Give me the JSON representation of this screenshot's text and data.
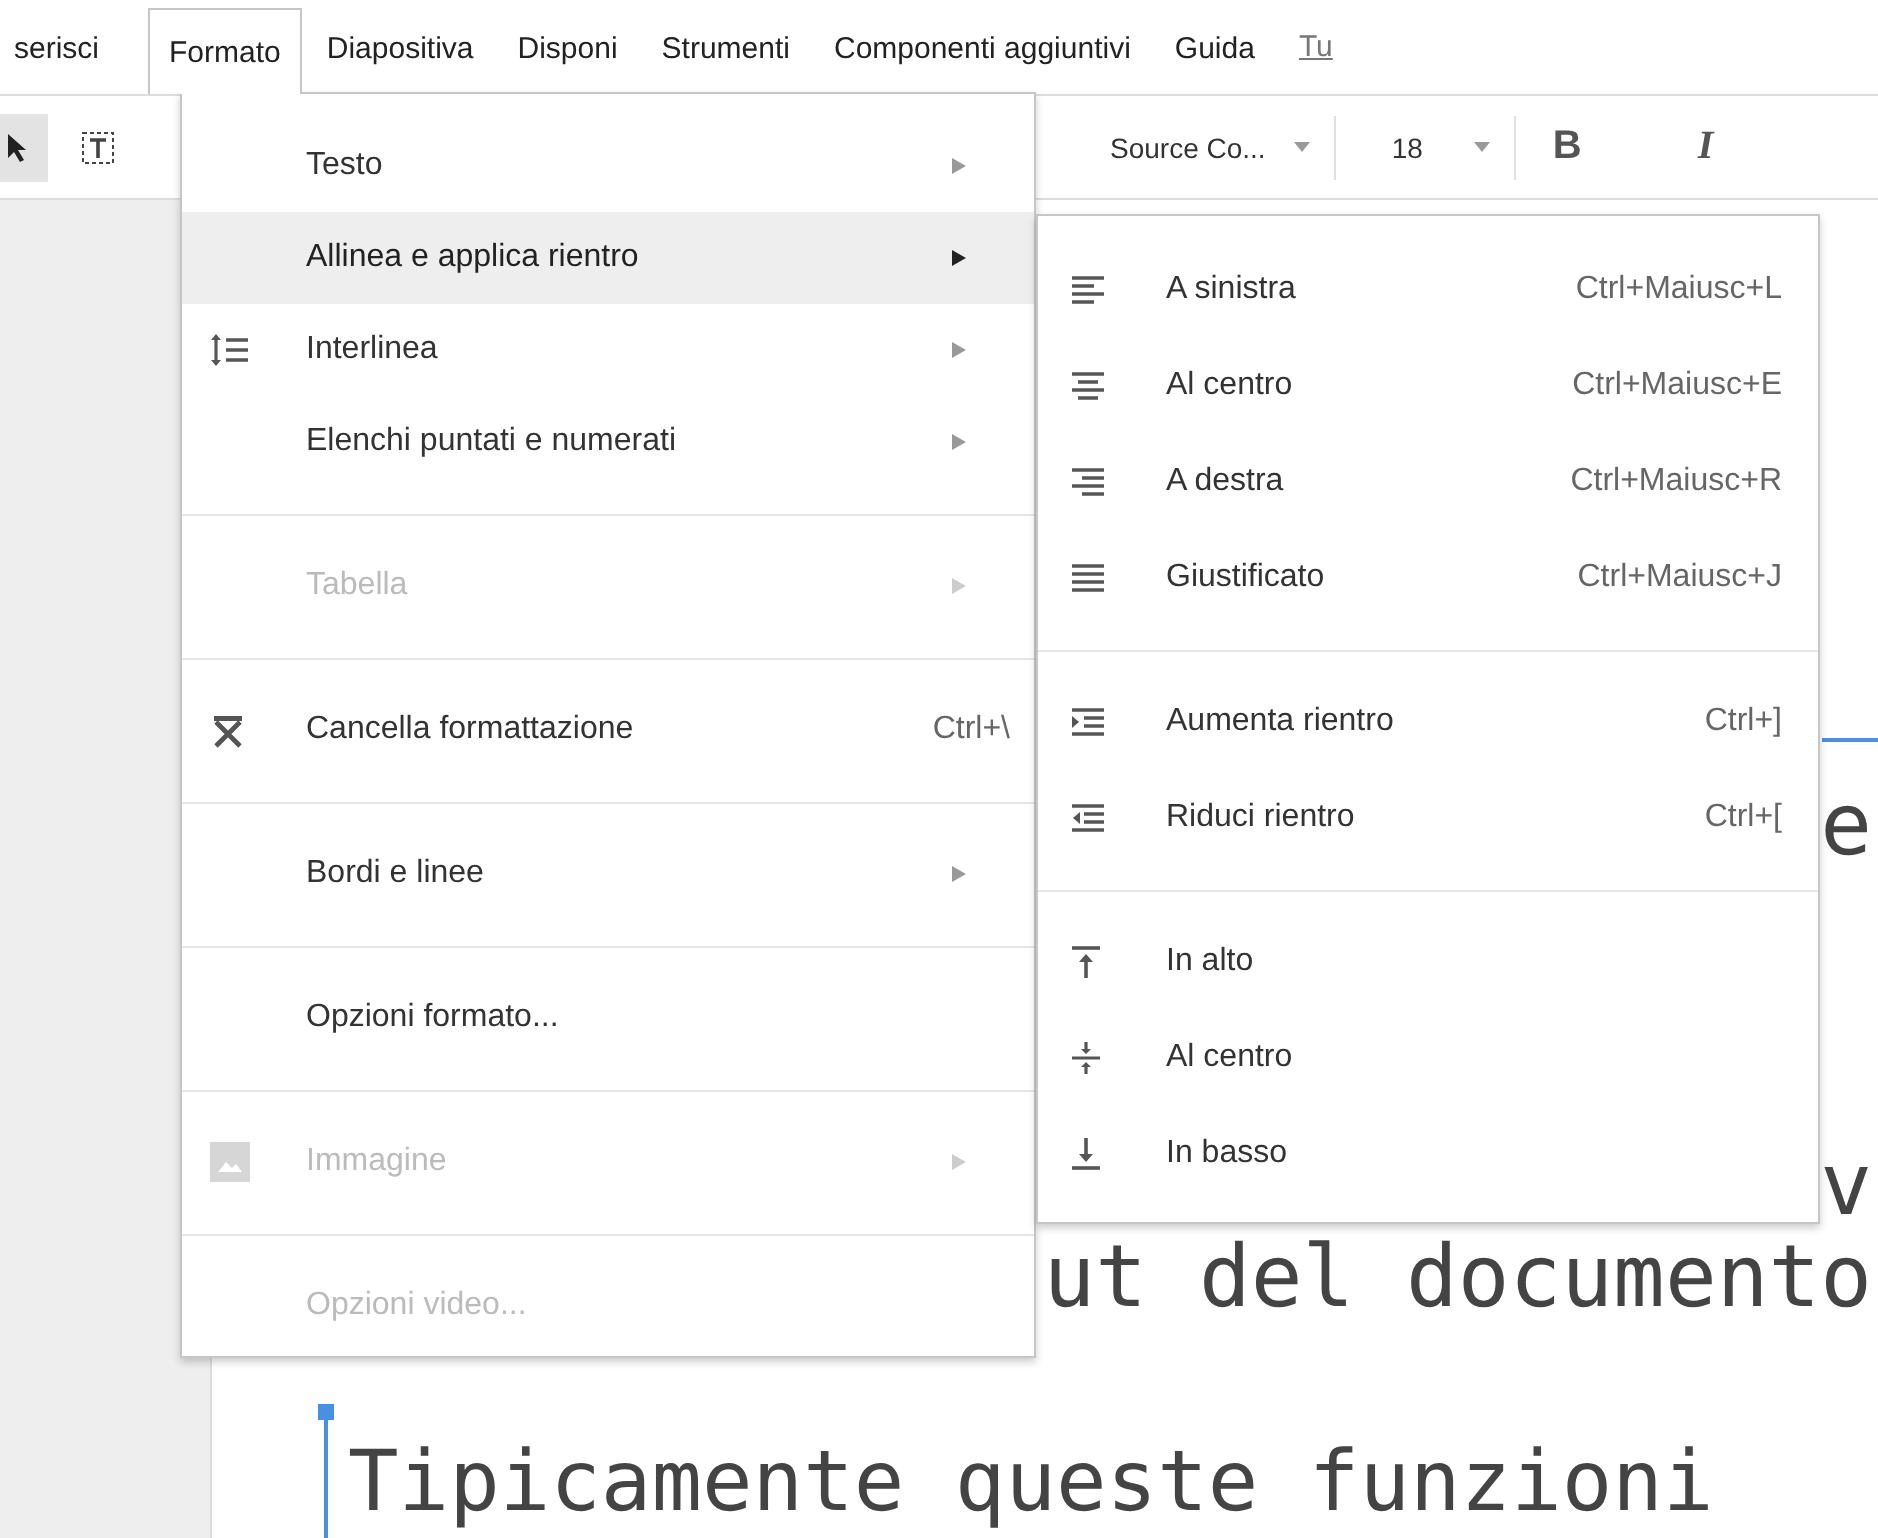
{
  "menubar": {
    "items": [
      {
        "label": "serisci",
        "selected": false
      },
      {
        "label": "Formato",
        "selected": true
      },
      {
        "label": "Diapositiva",
        "selected": false
      },
      {
        "label": "Disponi",
        "selected": false
      },
      {
        "label": "Strumenti",
        "selected": false
      },
      {
        "label": "Componenti aggiuntivi",
        "selected": false
      },
      {
        "label": "Guida",
        "selected": false
      }
    ],
    "status_link": "Tu"
  },
  "toolbar": {
    "tools": [
      {
        "kind": "pointer",
        "selected": true
      },
      {
        "kind": "textbox",
        "selected": false
      }
    ],
    "font": "Source Co...",
    "size": "18",
    "bold": "B",
    "italic": "I"
  },
  "slide": {
    "lines": [
      "e",
      "v",
      "ut del documento"
    ],
    "text_box": "Tipicamente queste funzioni"
  },
  "menu": {
    "items": [
      {
        "kind": "item",
        "label": "Testo",
        "submenu": true,
        "disabled": false,
        "selected": false
      },
      {
        "kind": "item",
        "label": "Allinea e applica rientro",
        "submenu": true,
        "disabled": false,
        "selected": true
      },
      {
        "kind": "item",
        "label": "Interlinea",
        "submenu": true,
        "disabled": false,
        "selected": false
      },
      {
        "kind": "item",
        "label": "Elenchi puntati e numerati",
        "submenu": true,
        "disabled": false,
        "selected": false
      },
      {
        "kind": "separator"
      },
      {
        "kind": "item",
        "label": "Tabella",
        "submenu": true,
        "disabled": true,
        "selected": false
      },
      {
        "kind": "separator"
      },
      {
        "kind": "item",
        "label": "Cancella formattazione",
        "shortcut": "Ctrl+\\",
        "submenu": false,
        "disabled": false,
        "selected": false
      },
      {
        "kind": "separator"
      },
      {
        "kind": "item",
        "label": "Bordi e linee",
        "submenu": true,
        "disabled": false,
        "selected": false
      },
      {
        "kind": "separator"
      },
      {
        "kind": "item",
        "label": "Opzioni formato...",
        "submenu": false,
        "disabled": false,
        "selected": false
      },
      {
        "kind": "separator"
      },
      {
        "kind": "item",
        "label": "Immagine",
        "submenu": true,
        "disabled": true,
        "selected": false
      },
      {
        "kind": "separator"
      },
      {
        "kind": "item",
        "label": "Opzioni video...",
        "submenu": false,
        "disabled": true,
        "selected": false
      }
    ]
  },
  "submenu": {
    "items": [
      {
        "kind": "item",
        "label": "A sinistra",
        "shortcut": "Ctrl+Maiusc+L",
        "selected": false
      },
      {
        "kind": "item",
        "label": "Al centro",
        "shortcut": "Ctrl+Maiusc+E",
        "selected": false
      },
      {
        "kind": "item",
        "label": "A destra",
        "shortcut": "Ctrl+Maiusc+R",
        "selected": false
      },
      {
        "kind": "item",
        "label": "Giustificato",
        "shortcut": "Ctrl+Maiusc+J",
        "selected": false
      },
      {
        "kind": "separator"
      },
      {
        "kind": "item",
        "label": "Aumenta rientro",
        "shortcut": "Ctrl+]",
        "selected": false
      },
      {
        "kind": "item",
        "label": "Riduci rientro",
        "shortcut": "Ctrl+[",
        "selected": false
      },
      {
        "kind": "separator"
      },
      {
        "kind": "item",
        "label": "In alto",
        "selected": false
      },
      {
        "kind": "item",
        "label": "Al centro",
        "selected": false
      },
      {
        "kind": "item",
        "label": "In basso",
        "selected": false
      }
    ]
  }
}
